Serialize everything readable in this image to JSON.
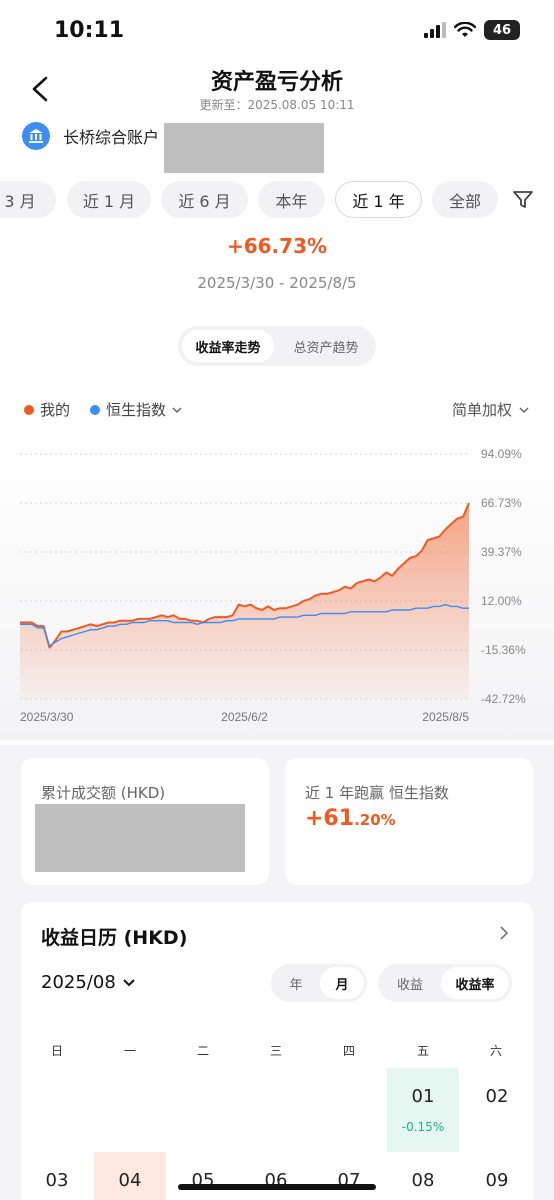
{
  "status_bar": {
    "time": "10:11",
    "battery": "46"
  },
  "header": {
    "title": "资产盈亏分析",
    "updated": "更新至：2025.08.05 10:11"
  },
  "account": {
    "name": "长桥综合账户"
  },
  "period_tabs": [
    {
      "label": "3 月",
      "active": false
    },
    {
      "label": "近 1 月",
      "active": false
    },
    {
      "label": "近 6 月",
      "active": false
    },
    {
      "label": "本年",
      "active": false
    },
    {
      "label": "近 1 年",
      "active": true
    },
    {
      "label": "全部",
      "active": false
    }
  ],
  "summary": {
    "return_pct": "+66.73%",
    "date_range": "2025/3/30 - 2025/8/5"
  },
  "chart_toggle": {
    "active": "收益率走势",
    "inactive": "总资产趋势"
  },
  "legend": {
    "mine": "我的",
    "index": "恒生指数",
    "weighting": "简单加权"
  },
  "colors": {
    "accent": "#f05a22",
    "index": "#3d8df5",
    "gain_green": "#1db38a"
  },
  "chart_data": {
    "type": "line",
    "y_tick_labels": [
      "94.09%",
      "66.73%",
      "39.37%",
      "12.00%",
      "-15.36%",
      "-42.72%"
    ],
    "ylim": [
      -42.72,
      94.09
    ],
    "x_tick_labels": [
      "2025/3/30",
      "2025/6/2",
      "2025/8/5"
    ],
    "grid": true,
    "series": [
      {
        "name": "我的",
        "color": "#f05a22",
        "fill": true,
        "values": [
          0,
          0,
          0,
          -2,
          -2,
          -14,
          -10,
          -5,
          -5,
          -4,
          -3,
          -2,
          -1,
          -2,
          -1,
          0,
          0,
          1,
          1,
          1,
          2,
          2,
          2,
          3,
          4,
          3,
          4,
          2,
          2,
          1,
          1,
          0,
          2,
          3,
          3,
          3,
          4,
          10,
          9,
          10,
          8,
          7,
          9,
          7,
          8,
          8,
          9,
          10,
          12,
          13,
          15,
          16,
          16,
          17,
          18,
          20,
          19,
          22,
          23,
          24,
          23,
          25,
          28,
          26,
          30,
          33,
          36,
          37,
          40,
          46,
          47,
          48,
          52,
          55,
          58,
          59,
          66.73
        ]
      },
      {
        "name": "恒生指数",
        "color": "#3d8df5",
        "fill": false,
        "values": [
          -1,
          -1,
          -1,
          -3,
          -3,
          -13,
          -11,
          -9,
          -8,
          -7,
          -6,
          -5,
          -4,
          -4,
          -3,
          -2,
          -2,
          -1,
          -1,
          0,
          0,
          0,
          1,
          1,
          1,
          1,
          0,
          0,
          0,
          0,
          -1,
          0,
          0,
          0,
          0,
          1,
          1,
          2,
          2,
          2,
          2,
          2,
          2,
          2,
          3,
          3,
          3,
          3,
          4,
          4,
          4,
          5,
          5,
          5,
          5,
          5,
          6,
          6,
          6,
          6,
          6,
          6,
          6,
          7,
          7,
          7,
          7,
          8,
          8,
          8,
          9,
          9,
          10,
          9,
          9,
          8,
          8
        ]
      }
    ]
  },
  "cards": {
    "turnover_label": "累计成交额 (HKD)",
    "beat_label": "近 1 年跑赢 恒生指数",
    "beat_main": "+61",
    "beat_decimal": ".20%"
  },
  "calendar": {
    "title": "收益日历 (HKD)",
    "month": "2025/08",
    "scope_options": [
      "年",
      "月"
    ],
    "scope_active": "月",
    "metric_options": [
      "收益",
      "收益率"
    ],
    "metric_active": "收益率",
    "weekdays": [
      "日",
      "一",
      "二",
      "三",
      "四",
      "五",
      "六"
    ],
    "week1": [
      {
        "day": "01",
        "value": "-0.15%"
      },
      {
        "day": "02",
        "value": ""
      }
    ],
    "week2": [
      "03",
      "04",
      "05",
      "06",
      "07",
      "08",
      "09"
    ]
  }
}
